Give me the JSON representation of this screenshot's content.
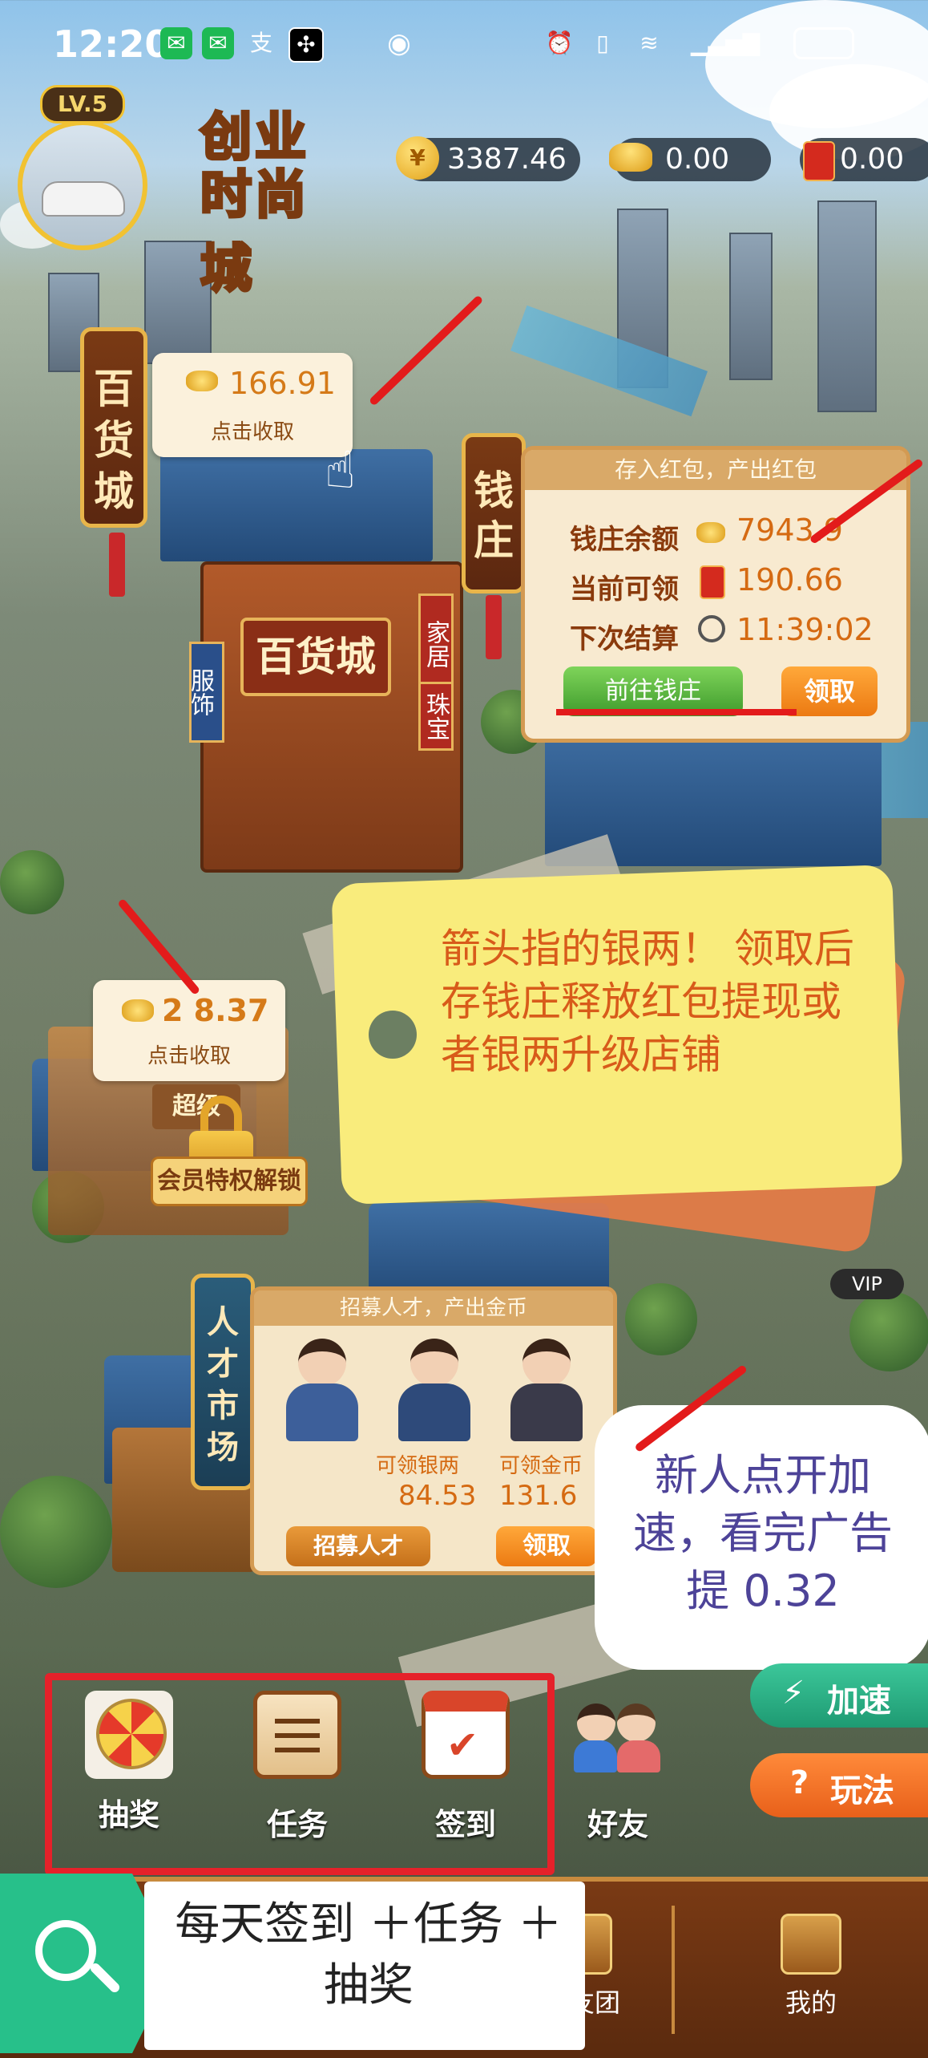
{
  "status_bar": {
    "time": "12:20"
  },
  "player": {
    "level": "LV.5"
  },
  "logo": {
    "line1": "创业",
    "line2": "时尚城"
  },
  "currencies": {
    "gold": "3387.46",
    "silver": "0.00",
    "redpacket": "0.00"
  },
  "department_store": {
    "sign": "百货城",
    "facade": "百货城",
    "side_left": "服饰",
    "side_right_1": "家居",
    "side_right_2": "珠宝",
    "collect_amount": "166.91",
    "collect_label": "点击收取"
  },
  "qianzhuang": {
    "sign": "钱庄",
    "header": "存入红包，产出红包",
    "rows": [
      {
        "label": "钱庄余额",
        "value": "7943.9"
      },
      {
        "label": "当前可领",
        "value": "190.66"
      },
      {
        "label": "下次结算",
        "value": "11:39:02"
      }
    ],
    "goto_label": "前往钱庄",
    "claim_label": "领取"
  },
  "super_shop": {
    "collect_amount": "2 8.37",
    "collect_label": "点击收取",
    "sign": "超级",
    "unlock_label": "会员特权解锁"
  },
  "annotation_tag": {
    "text": "箭头指的银两！ 领取后存钱庄释放红包提现或者银两升级店铺"
  },
  "vip_label": "VIP",
  "talent_market": {
    "sign": "人才市场",
    "header": "招募人才，产出金币",
    "silver_label": "可领银两",
    "silver_value": "84.53",
    "gold_label": "可领金币",
    "gold_value": "131.6",
    "recruit_label": "招募人才",
    "claim_label": "领取"
  },
  "annotation_bubble": {
    "text": "新人点开加速，看完广告提 0.32"
  },
  "side_buttons": {
    "speed": "加速",
    "howto": "玩法"
  },
  "actions": [
    {
      "label": "抽奖",
      "icon": "lottery-wheel-icon"
    },
    {
      "label": "任务",
      "icon": "scroll-icon"
    },
    {
      "label": "签到",
      "icon": "calendar-check-icon"
    },
    {
      "label": "好友",
      "icon": "friends-icon"
    }
  ],
  "bottom_nav": {
    "friends_group": "亲友团",
    "mine": "我的"
  },
  "annotation_bottom": {
    "text": "每天签到 ＋任务 ＋抽奖"
  }
}
